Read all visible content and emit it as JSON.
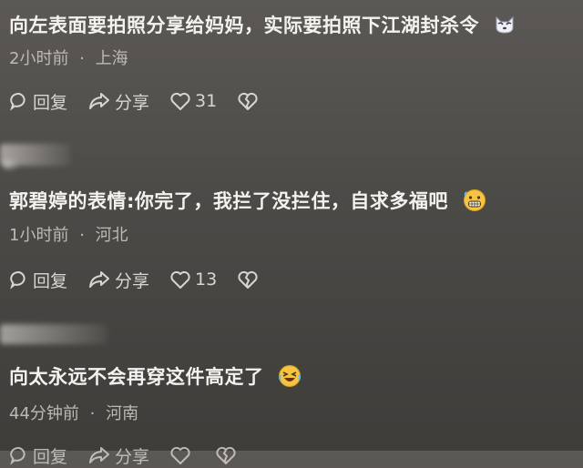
{
  "comments": [
    {
      "text": "向左表面要拍照分享给妈妈，实际要拍照下江湖封杀令",
      "time": "2小时前",
      "location": "上海",
      "reply_label": "回复",
      "share_label": "分享",
      "likes": "31",
      "emoji": "cat-face-icon"
    },
    {
      "text": "郭碧婷的表情:你完了，我拦了没拦住，自求多福吧",
      "time": "1小时前",
      "location": "河北",
      "reply_label": "回复",
      "share_label": "分享",
      "likes": "13",
      "emoji": "grimacing-face-icon"
    },
    {
      "text": "向太永远不会再穿这件高定了",
      "time": "44分钟前",
      "location": "河南",
      "reply_label": "回复",
      "share_label": "分享",
      "likes": "",
      "emoji": "rolling-laughing-face-icon"
    }
  ],
  "separator": "·"
}
